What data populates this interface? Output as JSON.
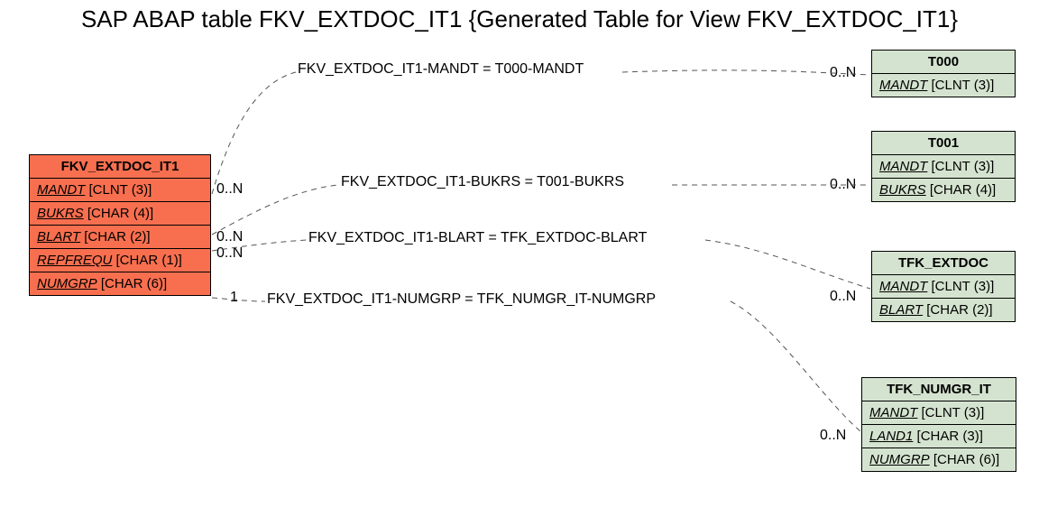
{
  "title": "SAP ABAP table FKV_EXTDOC_IT1 {Generated Table for View FKV_EXTDOC_IT1}",
  "colors": {
    "main": "#f86f4f",
    "ref": "#d4e3cf"
  },
  "main": {
    "name": "FKV_EXTDOC_IT1",
    "fields": [
      {
        "key": "MANDT",
        "type": "[CLNT (3)]"
      },
      {
        "key": "BUKRS",
        "type": "[CHAR (4)]"
      },
      {
        "key": "BLART",
        "type": "[CHAR (2)]"
      },
      {
        "key": "REPFREQU",
        "type": "[CHAR (1)]"
      },
      {
        "key": "NUMGRP",
        "type": "[CHAR (6)]"
      }
    ]
  },
  "refs": [
    {
      "name": "T000",
      "fields": [
        {
          "key": "MANDT",
          "type": "[CLNT (3)]"
        }
      ]
    },
    {
      "name": "T001",
      "fields": [
        {
          "key": "MANDT",
          "type": "[CLNT (3)]"
        },
        {
          "key": "BUKRS",
          "type": "[CHAR (4)]"
        }
      ]
    },
    {
      "name": "TFK_EXTDOC",
      "fields": [
        {
          "key": "MANDT",
          "type": "[CLNT (3)]"
        },
        {
          "key": "BLART",
          "type": "[CHAR (2)]"
        }
      ]
    },
    {
      "name": "TFK_NUMGR_IT",
      "fields": [
        {
          "key": "MANDT",
          "type": "[CLNT (3)]"
        },
        {
          "key": "LAND1",
          "type": "[CHAR (3)]"
        },
        {
          "key": "NUMGRP",
          "type": "[CHAR (6)]"
        }
      ]
    }
  ],
  "relations": [
    {
      "label": "FKV_EXTDOC_IT1-MANDT = T000-MANDT",
      "cardL": "0..N",
      "cardR": "0..N"
    },
    {
      "label": "FKV_EXTDOC_IT1-BUKRS = T001-BUKRS",
      "cardL": "0..N",
      "cardR": "0..N"
    },
    {
      "label": "FKV_EXTDOC_IT1-BLART = TFK_EXTDOC-BLART",
      "cardL": "0..N",
      "cardR": "0..N"
    },
    {
      "label": "FKV_EXTDOC_IT1-NUMGRP = TFK_NUMGR_IT-NUMGRP",
      "cardL": "1",
      "cardR": "0..N"
    }
  ]
}
